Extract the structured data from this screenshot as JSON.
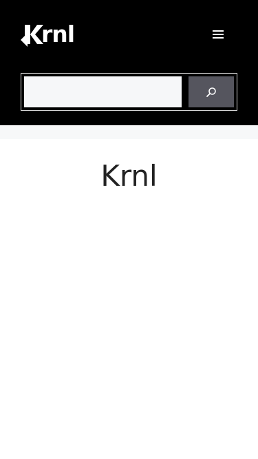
{
  "site": {
    "logo_text": "rnl",
    "logo_alt": "Krnl"
  },
  "header": {
    "menu_icon": "hamburger-menu-icon"
  },
  "search": {
    "value": "",
    "placeholder": "",
    "button_icon": "search-icon"
  },
  "page": {
    "title": "Krnl"
  },
  "colors": {
    "header_bg": "#000000",
    "search_button": "#55555e",
    "input_bg": "#f6f7f9",
    "strip_bg": "#f7f8f9",
    "title_text": "#222222"
  }
}
